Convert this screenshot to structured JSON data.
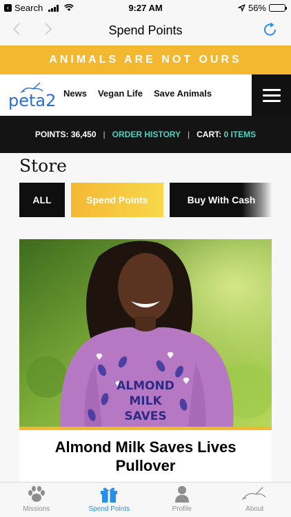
{
  "status_bar": {
    "back_label": "Search",
    "time": "9:27 AM",
    "battery": "56%",
    "battery_level": 0.56
  },
  "nav_bar": {
    "title": "Spend Points",
    "back_icon": "chevron-left-icon",
    "forward_icon": "chevron-right-icon",
    "refresh_icon": "refresh-icon"
  },
  "banner": {
    "text": "ANIMALS ARE NOT OURS"
  },
  "site_header": {
    "logo_text": "peta2",
    "nav_items": [
      "News",
      "Vegan Life",
      "Save Animals"
    ],
    "menu_icon": "hamburger-menu-icon"
  },
  "points_bar": {
    "points_label": "POINTS: 36,450",
    "separator": "|",
    "order_history": "ORDER HISTORY",
    "cart_label": "CART:",
    "cart_value": "0 ITEMS"
  },
  "store": {
    "title": "Store",
    "filters": [
      "ALL",
      "Spend Points",
      "Buy With Cash"
    ]
  },
  "product": {
    "shirt_text": [
      "ALMOND",
      "MILK",
      "SAVES"
    ],
    "title_line1": "Almond Milk Saves Lives",
    "title_line2": "Pullover"
  },
  "tab_bar": {
    "tabs": [
      {
        "label": "Missions",
        "icon": "paw-icon"
      },
      {
        "label": "Spend Points",
        "icon": "gift-icon"
      },
      {
        "label": "Profile",
        "icon": "person-icon"
      },
      {
        "label": "About",
        "icon": "bunny-icon"
      }
    ],
    "active_index": 1
  },
  "colors": {
    "accent_yellow": "#f4b730",
    "teal": "#4cd2c0",
    "active_tab": "#2a8de6",
    "dark": "#141414"
  }
}
